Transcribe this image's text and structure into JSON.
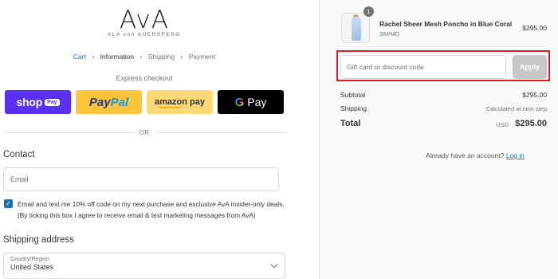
{
  "logo": {
    "main": "AvA",
    "sub": "ALA von AUERSPERG"
  },
  "breadcrumb": {
    "items": [
      "Cart",
      "Information",
      "Shipping",
      "Payment"
    ],
    "separator": "›"
  },
  "express": {
    "title": "Express checkout",
    "shoppay": {
      "label": "shop",
      "pill": "Pay",
      "color": "#5a31f4"
    },
    "paypal": {
      "part1": "Pay",
      "part2": "Pal",
      "color": "#ffc439"
    },
    "amazon": {
      "label": "amazon pay",
      "color": "#ffd978"
    },
    "gpay": {
      "g": "G",
      "label": "Pay",
      "color": "#000000"
    }
  },
  "or_text": "OR",
  "contact": {
    "title": "Contact",
    "account_prompt": "Already have an account?",
    "login_label": "Log in",
    "email_placeholder": "Email",
    "marketing_checked": true,
    "marketing_text": "Email and text me 10% off code on my next purchase and exclusive AvA insider-only deals. (By ticking this box I agree to receive email & text marketing messages from AvA)"
  },
  "shipping": {
    "title": "Shipping address",
    "country_label": "Country/Region",
    "country_value": "United States"
  },
  "cart": {
    "quantity": "1",
    "product_name": "Rachel Sheer Mesh Poncho in Blue Coral",
    "variant": "SM/MD",
    "price": "$295.00"
  },
  "discount": {
    "placeholder": "Gift card or discount code",
    "apply_label": "Apply",
    "highlight_color": "#e21b23"
  },
  "summary": {
    "subtotal_label": "Subtotal",
    "subtotal_value": "$295.00",
    "shipping_label": "Shipping",
    "shipping_value": "Calculated at next step",
    "total_label": "Total",
    "total_currency": "USD",
    "total_value": "$295.00"
  },
  "colors": {
    "link": "#1773b0",
    "accent_shoppay": "#5a31f4",
    "apply_disabled": "#c8c8c8"
  }
}
